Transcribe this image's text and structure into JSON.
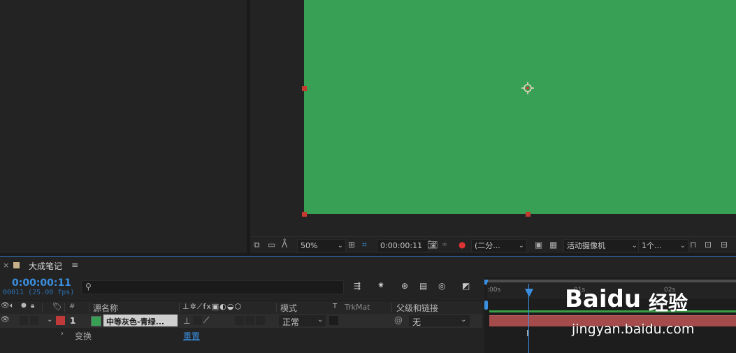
{
  "viewer": {
    "zoom": "50%",
    "timecode": "0:00:00:11",
    "resolution": "(二分...",
    "camera": "活动摄像机",
    "views": "1个...",
    "canvas_color": "#38a055"
  },
  "timeline": {
    "tab_title": "大成笔记",
    "timecode": "0:00:00:11",
    "frames": "00011 (25.00 fps)",
    "search_placeholder": "",
    "headers": {
      "hash": "#",
      "source_name": "源名称",
      "mode": "模式",
      "t": "T",
      "trkmat": "TrkMat",
      "parent": "父级和链接"
    },
    "layer": {
      "number": "1",
      "name": "中等灰色-青绿...",
      "mode": "正常",
      "parent": "无",
      "label_color": "#c03a3a",
      "swatch_color": "#38a055"
    },
    "transform": {
      "label": "变换",
      "reset": "重置"
    },
    "ruler": {
      "t0": ":00s",
      "t1": "01s",
      "t2": "02s"
    }
  },
  "watermark": {
    "brand": "Baidu",
    "product": "经验",
    "url": "jingyan.baidu.com"
  }
}
